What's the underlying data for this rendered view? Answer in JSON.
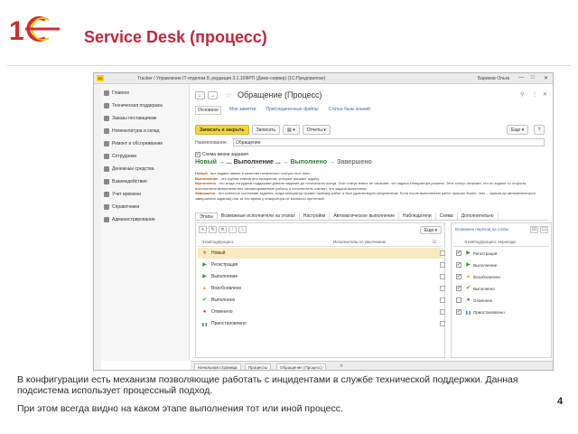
{
  "slide": {
    "title": "Service Desk (процесс)",
    "paragraph1": "В конфигурации есть механизм позволяющие работать с инцидентами в службе технической поддержки. Данная подсистема использует процессный подход.",
    "paragraph2": "При этом всегда видно на каком этапе выполнения тот или иной процесс.",
    "page_number": "4",
    "brand_color": "#c0283c"
  },
  "window": {
    "title": "Tracker / Управление IT-отделом 8, редакция 3.1.10ФРП (Демо-сервер) (1С:Предприятие)",
    "user": "Баринов Ольга",
    "controls": [
      "—",
      "□",
      "✕"
    ]
  },
  "nav": {
    "items": [
      {
        "label": "Главное",
        "icon": "home-icon"
      },
      {
        "label": "Техническая поддержка",
        "icon": "support-icon"
      },
      {
        "label": "Заказы поставщикам",
        "icon": "orders-icon"
      },
      {
        "label": "Номенклатура и склад",
        "icon": "warehouse-icon"
      },
      {
        "label": "Ремонт и обслуживание",
        "icon": "repair-icon"
      },
      {
        "label": "Сотрудники",
        "icon": "employees-icon"
      },
      {
        "label": "Денежные средства",
        "icon": "money-icon"
      },
      {
        "label": "Взаимодействия",
        "icon": "interactions-icon"
      },
      {
        "label": "Учет времени",
        "icon": "clock-icon"
      },
      {
        "label": "Справочники",
        "icon": "book-icon"
      },
      {
        "label": "Администрирование",
        "icon": "gear-icon"
      }
    ]
  },
  "doc": {
    "back": "←",
    "forward": "→",
    "title": "Обращение (Процесс)",
    "header_icons": [
      "⚲",
      "⋮",
      "✕"
    ],
    "tabs": [
      "Основное",
      "Мои заметки",
      "Присоединенные файлы",
      "Статьи базы знаний"
    ],
    "toolbar": {
      "save_close": "Записать и закрыть",
      "save": "Записать",
      "print": "▾",
      "reports": "Отчеты ▾",
      "more": "Еще ▾",
      "help": "?"
    },
    "name_label": "Наименование:",
    "name_value": "Обращение",
    "scheme_label": "Схема жизни задания",
    "flow": {
      "new": "Новый",
      "arrow1": " → ... Выполнение ... ",
      "arrow2": "→ Выполнено ",
      "closed": "→ Завершено"
    },
    "desc": [
      {
        "term": "Новый",
        "text": " - все задачи имеют в качестве начального статуса этот этап"
      },
      {
        "term": "Выполнение",
        "text": " - это группа этапов или процессов, которые решают задачу."
      },
      {
        "term": "Выполнено",
        "text": " - это когда сотрудник поддержки довели задание до логического конца. Этот статус вовсе не означает, что задача Инициатора решена. Этот статус означает, что по задаче со стороны исполнителя выполнены все запланированные работы и исполнитель считает, что задача выполнена"
      },
      {
        "term": "Завершено",
        "text": " - это конечное состояние задания, когда инициатор провел приемку работ и был удовлетворен результатом. Если после выполнения работ прошло более, чем ... (время до автоматического завершения задания) или за это время у инициатора не возникли претензий."
      }
    ]
  },
  "process": {
    "tabs": [
      "Этапы",
      "Возможные исполнители на этапах",
      "Настройки",
      "Автоматическое выполнение",
      "Наблюдатели",
      "Схема",
      "Дополнительно"
    ],
    "toolbar_left": [
      "+",
      "✎",
      "✕",
      "↑",
      "↓"
    ],
    "col_stage": "Этап/подпроцесс",
    "col_executor": "Исполнитель по умолчанию",
    "stages": [
      {
        "label": "Новый",
        "icon": "new-icon",
        "symbol": "■",
        "color": "#e8962c"
      },
      {
        "label": "Регистрация",
        "icon": "play-icon",
        "symbol": "▶",
        "color": "#2e9e3e"
      },
      {
        "label": "Выполнение",
        "icon": "play-icon",
        "symbol": "▶",
        "color": "#2e9e3e"
      },
      {
        "label": "Возобновлено",
        "icon": "warning-icon",
        "symbol": "▲",
        "color": "#e6b800"
      },
      {
        "label": "Выполнено",
        "icon": "check-icon",
        "symbol": "✔",
        "color": "#2e9e3e"
      },
      {
        "label": "Отменено",
        "icon": "cancel-icon",
        "symbol": "●",
        "color": "#d9342b"
      },
      {
        "label": "Приостановлено",
        "icon": "pause-icon",
        "symbol": "❚❚",
        "color": "#3b6db3"
      }
    ],
    "right_label": "Возможен переход на этапы",
    "right_col": "Этап/подпроцесс перехода",
    "transitions": [
      {
        "label": "Регистрация",
        "symbol": "▶",
        "color": "#2e9e3e",
        "checked": true
      },
      {
        "label": "Выполнение",
        "symbol": "▶",
        "color": "#2e9e3e",
        "checked": true
      },
      {
        "label": "Возобновлено",
        "symbol": "▲",
        "color": "#e6b800",
        "checked": true
      },
      {
        "label": "Выполнено",
        "symbol": "✔",
        "color": "#2e9e3e",
        "checked": true
      },
      {
        "label": "Отменено",
        "symbol": "●",
        "color": "#d9342b",
        "checked": false
      },
      {
        "label": "Приостановлено",
        "symbol": "❚❚",
        "color": "#3b6db3",
        "checked": true
      }
    ]
  },
  "taskbar": {
    "tabs": [
      "Начальная страница",
      "Процессы",
      "Обращение (Процесс)"
    ]
  }
}
